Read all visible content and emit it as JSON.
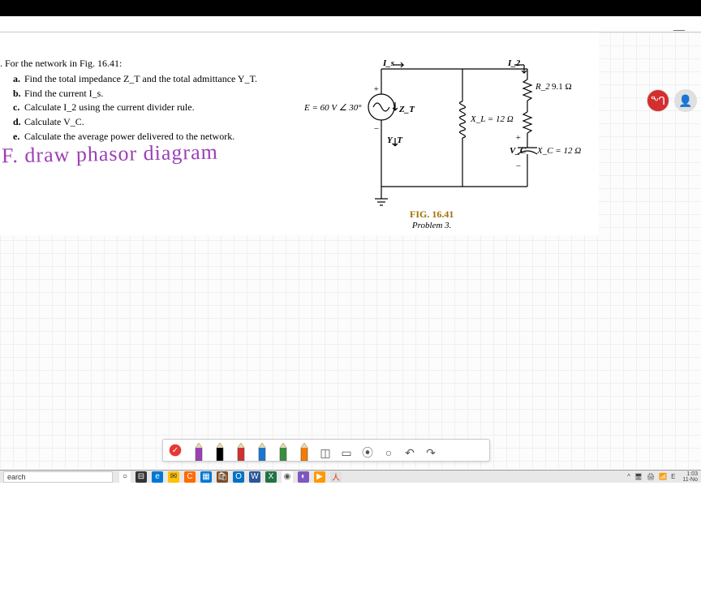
{
  "window": {
    "minimize": "—"
  },
  "problem": {
    "intro": ". For the network in Fig. 16.41:",
    "items": [
      {
        "lbl": "a.",
        "txt": "Find the total impedance Z_T and the total admittance Y_T."
      },
      {
        "lbl": "b.",
        "txt": "Find the current I_s."
      },
      {
        "lbl": "c.",
        "txt": "Calculate I_2 using the current divider rule."
      },
      {
        "lbl": "d.",
        "txt": "Calculate V_C."
      },
      {
        "lbl": "e.",
        "txt": "Calculate the average power delivered to the network."
      }
    ]
  },
  "handwriting": "F. draw phasor diagram",
  "circuit": {
    "source": "E = 60 V ∠ 30°",
    "I_s": "I_s",
    "I_2": "I_2",
    "R2": "R_2",
    "R2_val": "9.1 Ω",
    "XL": "X_L = 12 Ω",
    "XC": "X_C = 12 Ω",
    "VC": "V_C",
    "ZT": "Z_T",
    "YT": "Y_T",
    "plus": "+",
    "minus": "−"
  },
  "figure": {
    "num": "FIG. 16.41",
    "txt": "Problem 3."
  },
  "avatars": {
    "a1": "ᙰ",
    "a2": "👤"
  },
  "pens": [
    "#9b3fb5",
    "#000000",
    "#d32f2f",
    "#1976d2",
    "#388e3c",
    "#f57c00"
  ],
  "toolbar": {
    "check": "✓",
    "eraser": "◫",
    "eraser2": "▭",
    "ruler": "⦿",
    "lasso": "○",
    "undo": "↶",
    "redo": "↷"
  },
  "taskbar": {
    "search": "earch",
    "icons": [
      {
        "bg": "#fff",
        "c": "#000",
        "g": "○"
      },
      {
        "bg": "#333",
        "c": "#fff",
        "g": "⊟"
      },
      {
        "bg": "#0078d4",
        "c": "#fff",
        "g": "e"
      },
      {
        "bg": "#ffc107",
        "c": "#333",
        "g": "✉"
      },
      {
        "bg": "#ff6b00",
        "c": "#fff",
        "g": "C"
      },
      {
        "bg": "#0078d4",
        "c": "#fff",
        "g": "▦"
      },
      {
        "bg": "#7b4f2e",
        "c": "#fff",
        "g": "🛍"
      },
      {
        "bg": "#0072c6",
        "c": "#fff",
        "g": "O"
      },
      {
        "bg": "#2b579a",
        "c": "#fff",
        "g": "W"
      },
      {
        "bg": "#217346",
        "c": "#fff",
        "g": "X"
      },
      {
        "bg": "#fff",
        "c": "#555",
        "g": "◉"
      },
      {
        "bg": "#7e57c2",
        "c": "#fff",
        "g": "◐"
      },
      {
        "bg": "#ff9800",
        "c": "#fff",
        "g": "▶"
      },
      {
        "bg": "#e0e0e0",
        "c": "#d32",
        "g": "人"
      }
    ],
    "systray": {
      "up": "^",
      "i1": "🖥",
      "i2": "🖨",
      "i3": "📶",
      "lang": "E"
    },
    "clock": {
      "t": "1:03",
      "d": "11-No"
    }
  }
}
